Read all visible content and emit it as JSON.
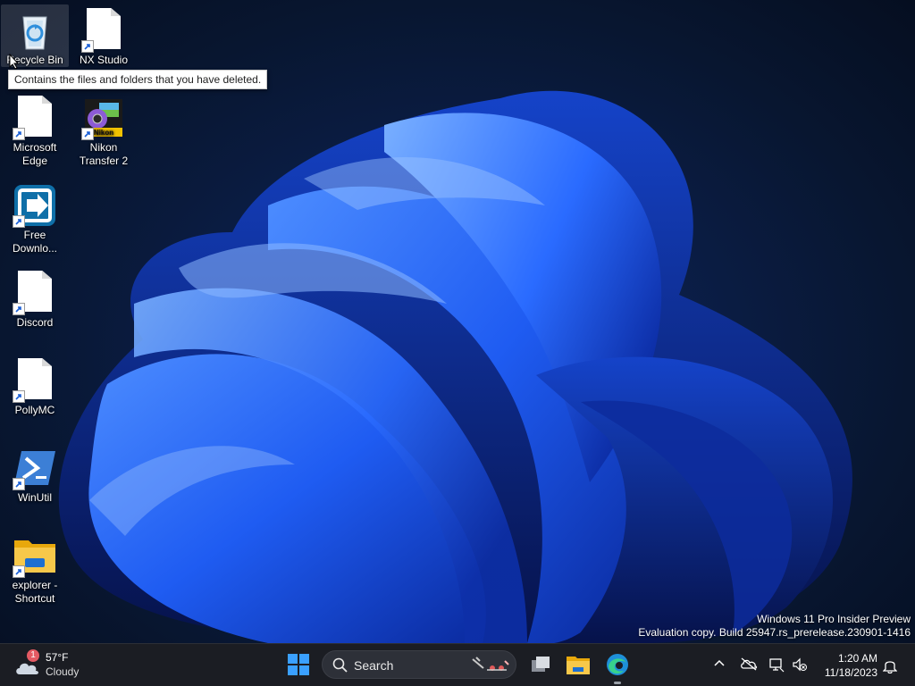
{
  "desktop": {
    "icons": [
      {
        "label": "Recycle Bin",
        "icon": "recycle-bin-icon"
      },
      {
        "label": "NX Studio",
        "icon": "file-shortcut-icon"
      },
      {
        "label": "Microsoft\nEdge",
        "icon": "file-shortcut-icon"
      },
      {
        "label": "Nikon\nTransfer 2",
        "icon": "nikon-transfer-icon"
      },
      {
        "label": "Free\nDownlo...",
        "icon": "free-download-manager-icon"
      },
      {
        "label": "Discord",
        "icon": "file-shortcut-icon"
      },
      {
        "label": "PollyMC",
        "icon": "file-shortcut-icon"
      },
      {
        "label": "WinUtil",
        "icon": "powershell-icon"
      },
      {
        "label": "explorer -\nShortcut",
        "icon": "folder-icon"
      }
    ],
    "tooltip": "Contains the files and folders that you have deleted.",
    "watermark": {
      "line1": "Windows 11 Pro Insider Preview",
      "line2": "Evaluation copy. Build 25947.rs_prerelease.230901-1416"
    }
  },
  "taskbar": {
    "weather": {
      "temp": "57°F",
      "condition": "Cloudy",
      "badge": "1"
    },
    "search": {
      "label": "Search"
    },
    "apps": [
      "task-view",
      "file-explorer",
      "microsoft-edge"
    ],
    "clock": {
      "time": "1:20 AM",
      "date": "11/18/2023"
    }
  },
  "colors": {
    "taskbar": "#1b1d23",
    "accent": "#1e6fff",
    "badge": "#e45a63"
  }
}
